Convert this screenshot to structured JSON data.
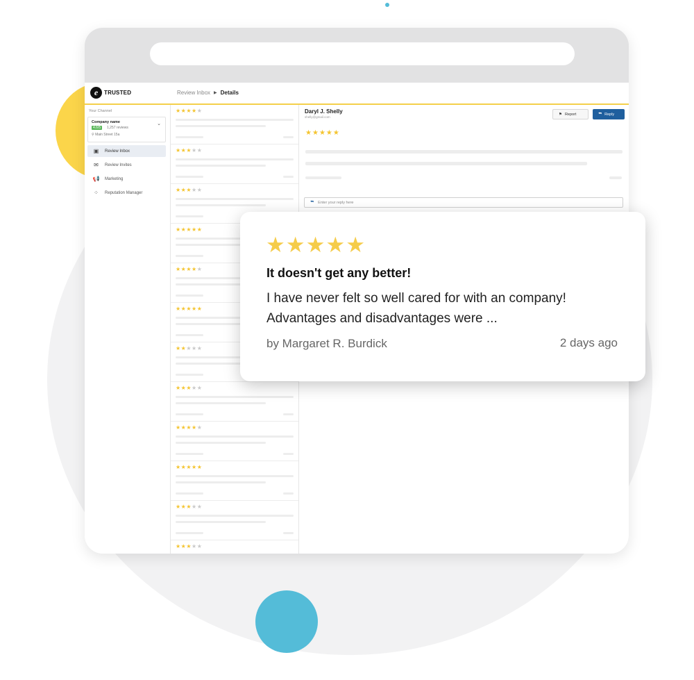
{
  "app": {
    "logo_glyph": "e",
    "logo_text": "TRUSTED",
    "breadcrumb": [
      "Review Inbox",
      "Details"
    ]
  },
  "sidebar": {
    "channel_label": "Your Channel",
    "company_name": "Company name",
    "rating": "4.6/5",
    "reviews_count": "1,257 reviews",
    "address": "Main Street 15a",
    "nav_items": [
      {
        "label": "Review Inbox",
        "icon": "inbox-icon",
        "active": true
      },
      {
        "label": "Review Invites",
        "icon": "envelope-icon",
        "active": false
      },
      {
        "label": "Marketing",
        "icon": "megaphone-icon",
        "active": false
      },
      {
        "label": "Reputation Manager",
        "icon": "network-icon",
        "active": false
      }
    ]
  },
  "review_list": {
    "ratings": [
      4,
      3,
      3,
      5,
      4,
      5,
      2,
      3,
      4,
      5,
      3,
      3
    ],
    "max_stars": 5
  },
  "detail": {
    "reviewer_name": "Daryl J. Shelly",
    "reviewer_email": "shelly@gmail.com",
    "rating": 5,
    "report_label": "Report",
    "reply_label": "Reply",
    "reply_placeholder": "Enter your reply here"
  },
  "popup": {
    "rating": 5,
    "title": "It doesn't get any better!",
    "body": "I have never felt so well cared for with an company! Advantages and disadvantages were ...",
    "author": "by Margaret R. Burdick",
    "time": "2 days ago"
  },
  "colors": {
    "accent_yellow": "#fbd54a",
    "accent_blue": "#54bcd8",
    "star": "#f4c430",
    "primary_button": "#1f5f9e",
    "badge_green": "#5cb85c"
  }
}
